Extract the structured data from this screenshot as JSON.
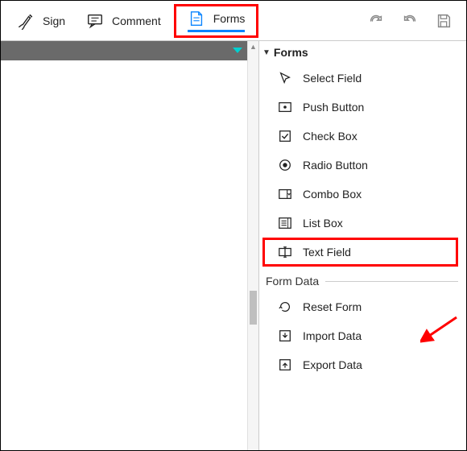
{
  "toolbar": {
    "sign": "Sign",
    "comment": "Comment",
    "forms": "Forms"
  },
  "panel": {
    "title": "Forms",
    "items": [
      {
        "label": "Select Field"
      },
      {
        "label": "Push Button"
      },
      {
        "label": "Check Box"
      },
      {
        "label": "Radio Button"
      },
      {
        "label": "Combo Box"
      },
      {
        "label": "List Box"
      },
      {
        "label": "Text Field"
      }
    ],
    "form_data_label": "Form Data",
    "data_items": [
      {
        "label": "Reset Form"
      },
      {
        "label": "Import Data"
      },
      {
        "label": "Export Data"
      }
    ]
  }
}
